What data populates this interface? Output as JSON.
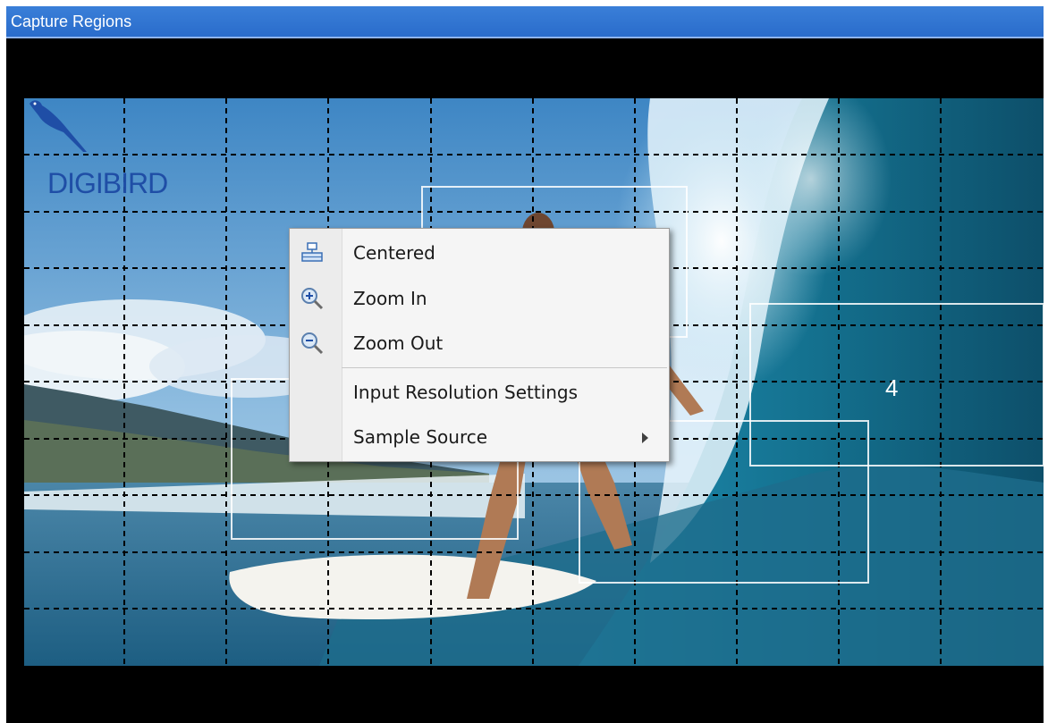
{
  "window": {
    "title": "Capture Regions"
  },
  "logo": {
    "text": "DIGIBIRD"
  },
  "regions": [
    {
      "label": "4"
    }
  ],
  "context_menu": {
    "items": [
      {
        "label": "Centered",
        "icon": "centered-icon"
      },
      {
        "label": "Zoom In",
        "icon": "zoom-in-icon"
      },
      {
        "label": "Zoom Out",
        "icon": "zoom-out-icon"
      },
      {
        "label": "Input Resolution Settings",
        "icon": ""
      },
      {
        "label": "Sample Source",
        "icon": "",
        "has_submenu": true
      }
    ]
  },
  "colors": {
    "title_bar": "#2a6ccb",
    "logo": "#1f4ea6",
    "grid_line": "#000000",
    "region_border": "#ffffff"
  }
}
